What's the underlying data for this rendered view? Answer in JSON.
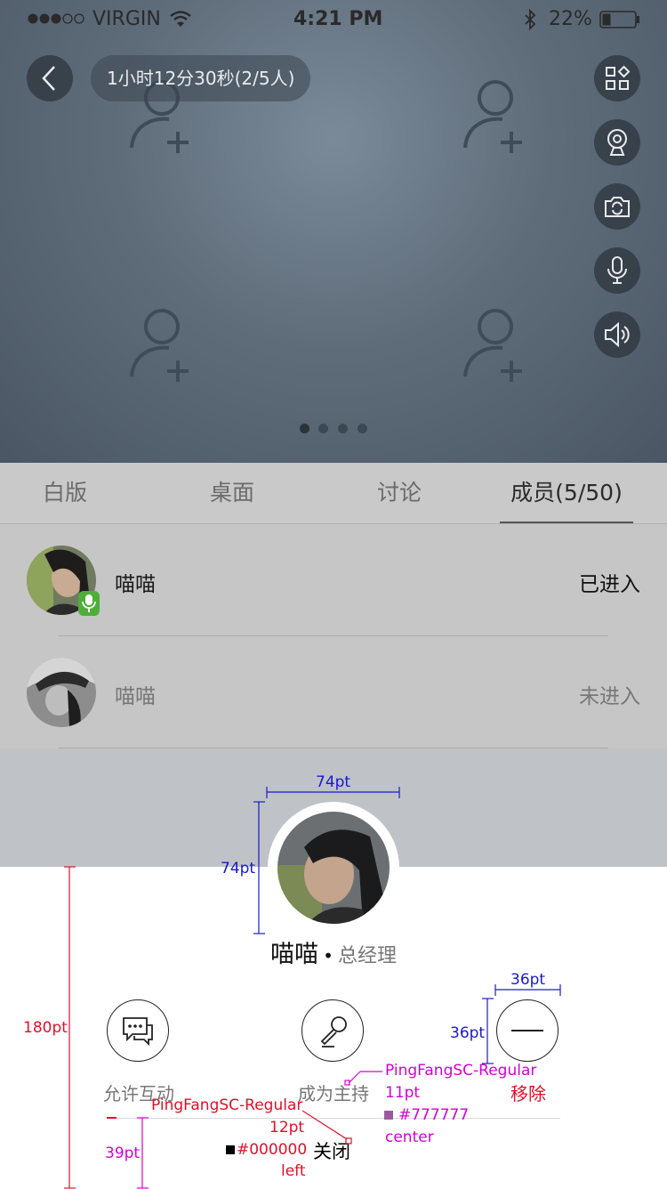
{
  "status_bar": {
    "carrier": "VIRGIN",
    "time": "4:21 PM",
    "battery": "22%"
  },
  "meeting": {
    "duration_label": "1小时12分30秒(2/5人)"
  },
  "side_controls": [
    "grid-icon",
    "webcam-icon",
    "camera-switch-icon",
    "microphone-icon",
    "speaker-icon"
  ],
  "pager": {
    "pages": 4,
    "active": 1
  },
  "tabs": [
    {
      "label": "白版"
    },
    {
      "label": "桌面"
    },
    {
      "label": "讨论"
    },
    {
      "label": "成员(5/50)"
    }
  ],
  "members": [
    {
      "name": "喵喵",
      "status": "已进入"
    },
    {
      "name": "喵喵",
      "status": "未进入"
    }
  ],
  "profile": {
    "name": "喵喵",
    "separator": "•",
    "role": "总经理"
  },
  "actions": [
    {
      "label": "允许互动"
    },
    {
      "label": "成为主持"
    },
    {
      "label": "移除"
    }
  ],
  "close_label": "关闭",
  "annotations": {
    "avatar_width": "74pt",
    "avatar_height": "74pt",
    "sheet_height": "180pt",
    "btn_width": "36pt",
    "btn_height": "36pt",
    "bottom_gap": "39pt",
    "spec_right": {
      "font": "PingFangSC-Regular",
      "size": "11pt",
      "color": "#777777",
      "align": "center"
    },
    "spec_left": {
      "font": "PingFangSC-Regular",
      "size": "12pt",
      "color": "#000000",
      "align": "left"
    }
  },
  "colors": {
    "remove": "#e0102a",
    "active_tab": "#2b2b2b",
    "label_gray": "#777777"
  }
}
